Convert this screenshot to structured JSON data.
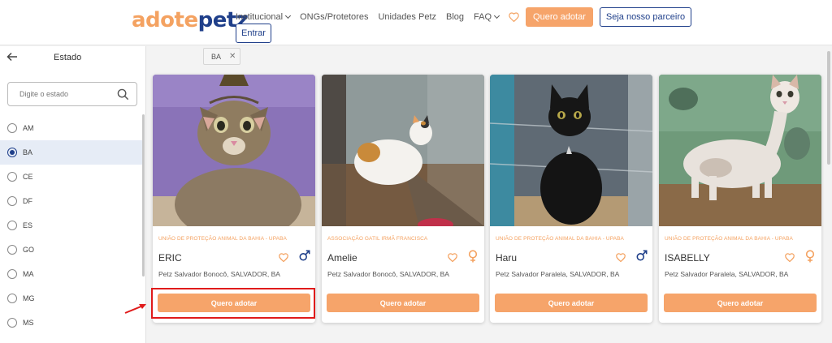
{
  "brand": {
    "part1": "adote",
    "part2": "petz",
    "accent": "#f6a46a",
    "navy": "#1f3f8a"
  },
  "nav": {
    "items": [
      {
        "label": "Institucional",
        "dropdown": true
      },
      {
        "label": "ONGs/Protetores",
        "dropdown": false
      },
      {
        "label": "Unidades Petz",
        "dropdown": false
      },
      {
        "label": "Blog",
        "dropdown": false
      },
      {
        "label": "FAQ",
        "dropdown": true
      }
    ],
    "adopt_label": "Quero adotar",
    "partner_label": "Seja nosso parceiro",
    "login_label": "Entrar",
    "favorites_icon": "heart-icon"
  },
  "sidebar": {
    "title": "Estado",
    "back_icon": "arrow-left-icon",
    "search_placeholder": "Digite o estado",
    "states": [
      "AM",
      "BA",
      "CE",
      "DF",
      "ES",
      "GO",
      "MA",
      "MG",
      "MS"
    ],
    "selected": "BA"
  },
  "filter_chip": {
    "label": "BA"
  },
  "cards": [
    {
      "org": "UNIÃO DE PROTEÇÃO ANIMAL DA BAHIA - UPABA",
      "name": "ERIC",
      "gender": "male",
      "location": "Petz Salvador Bonocô, SALVADOR, BA",
      "button": "Quero adotar"
    },
    {
      "org": "ASSOCIAÇÃO GATIL IRMÃ FRANCISCA",
      "name": "Amelie",
      "gender": "female",
      "location": "Petz Salvador Bonocô, SALVADOR, BA",
      "button": "Quero adotar"
    },
    {
      "org": "UNIÃO DE PROTEÇÃO ANIMAL DA BAHIA - UPABA",
      "name": "Haru",
      "gender": "male",
      "location": "Petz Salvador Paralela, SALVADOR, BA",
      "button": "Quero adotar"
    },
    {
      "org": "UNIÃO DE PROTEÇÃO ANIMAL DA BAHIA - UPABA",
      "name": "ISABELLY",
      "gender": "female",
      "location": "Petz Salvador Paralela, SALVADOR, BA",
      "button": "Quero adotar"
    }
  ],
  "colors": {
    "male": "#1f3f8a",
    "female": "#f4a261",
    "highlight": "#e01b1b"
  }
}
